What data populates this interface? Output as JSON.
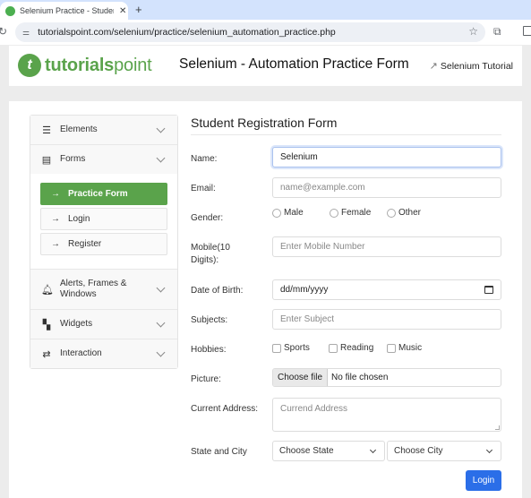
{
  "browser": {
    "tab_title": "Selenium Practice - Student F",
    "tab_close_icon": "close-icon",
    "new_tab_label": "+",
    "url": "tutorialspoint.com/selenium/practice/selenium_automation_practice.php",
    "icons": [
      "reload-icon",
      "site-info-icon",
      "bookmark-star-icon",
      "extensions-icon",
      "side-panel-icon"
    ]
  },
  "header": {
    "logo_mark": "t",
    "logo_bold": "tutorials",
    "logo_light": "point",
    "title": "Selenium - Automation Practice Form",
    "tutorial_link": "Selenium Tutorial"
  },
  "sidebar": {
    "sections": [
      {
        "label": "Elements",
        "icon": "menu-lines-icon"
      },
      {
        "label": "Forms",
        "icon": "list-form-icon",
        "expanded": true,
        "items": [
          {
            "label": "Practice Form",
            "active": true
          },
          {
            "label": "Login",
            "active": false
          },
          {
            "label": "Register",
            "active": false
          }
        ]
      },
      {
        "label": "Alerts, Frames & Windows",
        "icon": "bell-icon"
      },
      {
        "label": "Widgets",
        "icon": "widgets-grid-icon"
      },
      {
        "label": "Interaction",
        "icon": "swap-arrows-icon"
      }
    ]
  },
  "form": {
    "title": "Student Registration Form",
    "name": {
      "label": "Name:",
      "value": "Selenium"
    },
    "email": {
      "label": "Email:",
      "placeholder": "name@example.com"
    },
    "gender": {
      "label": "Gender:",
      "options": [
        "Male",
        "Female",
        "Other"
      ]
    },
    "mobile": {
      "label_line1": "Mobile(10",
      "label_line2": "Digits):",
      "placeholder": "Enter Mobile Number"
    },
    "dob": {
      "label": "Date of Birth:",
      "value": "dd/mm/yyyy"
    },
    "subjects": {
      "label": "Subjects:",
      "placeholder": "Enter Subject"
    },
    "hobbies": {
      "label": "Hobbies:",
      "options": [
        "Sports",
        "Reading",
        "Music"
      ]
    },
    "picture": {
      "label": "Picture:",
      "button": "Choose file",
      "status": "No file chosen"
    },
    "address": {
      "label": "Current Address:",
      "placeholder": "Currend Address"
    },
    "state_city": {
      "label": "State and City",
      "state": "Choose State",
      "city": "Choose City"
    },
    "submit": "Login"
  },
  "colors": {
    "brand_green": "#5aa34b",
    "primary_blue": "#2b6ee8",
    "chrome_tabbar": "#d3e3fd"
  }
}
